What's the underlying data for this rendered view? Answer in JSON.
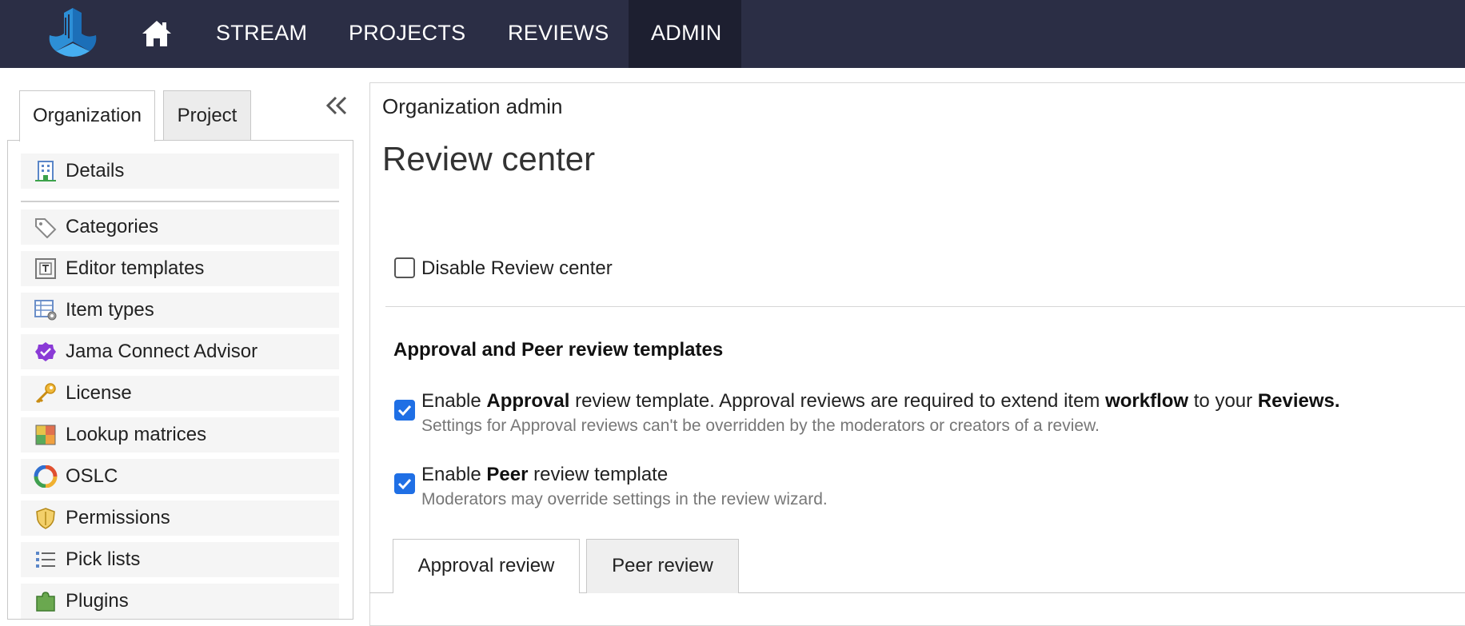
{
  "nav": {
    "items": [
      {
        "label": "STREAM"
      },
      {
        "label": "PROJECTS"
      },
      {
        "label": "REVIEWS"
      },
      {
        "label": "ADMIN",
        "active": true
      }
    ]
  },
  "sidebar": {
    "tabs": [
      {
        "label": "Organization",
        "active": true
      },
      {
        "label": "Project"
      }
    ],
    "items": [
      {
        "label": "Details",
        "icon": "building-icon"
      },
      {
        "label": "Categories",
        "icon": "tag-icon"
      },
      {
        "label": "Editor templates",
        "icon": "template-icon"
      },
      {
        "label": "Item types",
        "icon": "item-types-icon"
      },
      {
        "label": "Jama Connect Advisor",
        "icon": "advisor-badge-icon"
      },
      {
        "label": "License",
        "icon": "key-icon"
      },
      {
        "label": "Lookup matrices",
        "icon": "matrix-icon"
      },
      {
        "label": "OSLC",
        "icon": "oslc-ring-icon"
      },
      {
        "label": "Permissions",
        "icon": "shield-icon"
      },
      {
        "label": "Pick lists",
        "icon": "list-icon"
      },
      {
        "label": "Plugins",
        "icon": "puzzle-icon"
      }
    ]
  },
  "main": {
    "breadcrumb": "Organization admin",
    "title": "Review center",
    "disable_label": "Disable Review center",
    "disable_checked": false,
    "section_title": "Approval and Peer review templates",
    "approval": {
      "checked": true,
      "t1": "Enable ",
      "b1": "Approval",
      "t2": " review template. Approval reviews are required to extend item ",
      "b2": "workflow",
      "t3": " to your ",
      "b3": "Reviews.",
      "desc": "Settings for Approval reviews can't be overridden by the moderators or creators of a review."
    },
    "peer": {
      "checked": true,
      "t1": "Enable ",
      "b1": "Peer",
      "t2": " review template",
      "desc": "Moderators may override settings in the review wizard."
    },
    "review_tabs": [
      {
        "label": "Approval review",
        "active": true
      },
      {
        "label": "Peer review"
      }
    ]
  },
  "colors": {
    "nav_bg": "#2b2e45",
    "nav_active_bg": "#1d1f30",
    "checkbox_blue": "#1f6fe5"
  }
}
